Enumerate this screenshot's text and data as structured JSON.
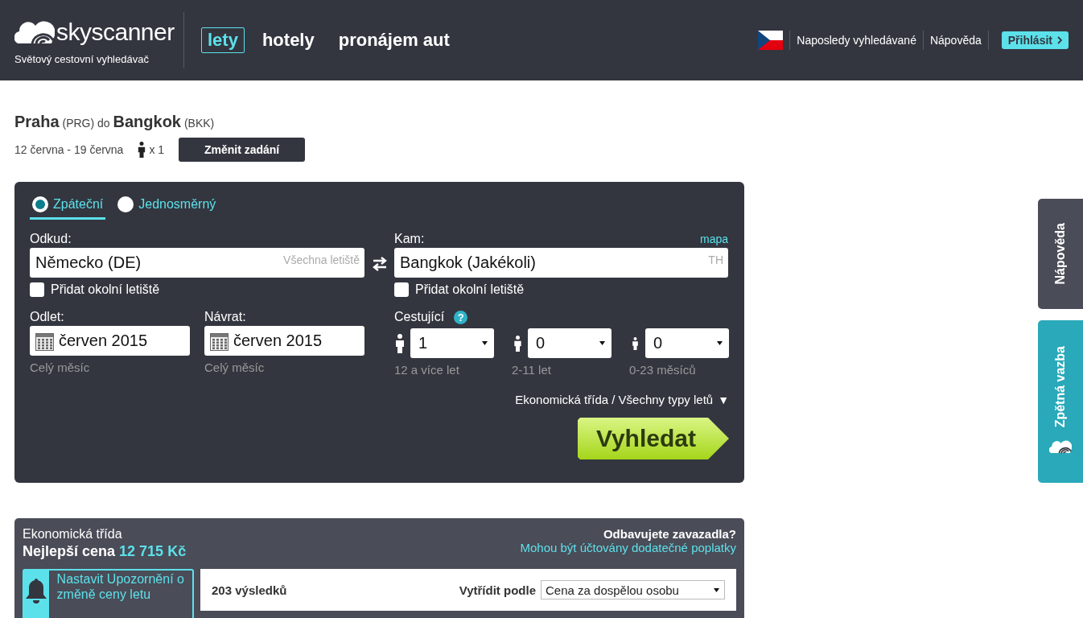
{
  "header": {
    "logo_text": "skyscanner",
    "tagline": "Světový cestovní vyhledávač",
    "nav": [
      {
        "label": "lety",
        "selected": true
      },
      {
        "label": "hotely",
        "selected": false
      },
      {
        "label": "pronájem aut",
        "selected": false
      }
    ],
    "links": [
      "Naposledy vyhledávané",
      "Nápověda"
    ],
    "login": "Přihlásit"
  },
  "summary": {
    "origin": "Praha",
    "origin_code": "(PRG)",
    "connector": "do",
    "destination": "Bangkok",
    "destination_code": "(BKK)",
    "dates": "12 června - 19 června",
    "travellers": "x 1",
    "change_button": "Změnit zadání"
  },
  "search_form": {
    "trip_types": [
      {
        "label": "Zpáteční",
        "selected": true
      },
      {
        "label": "Jednosměrný",
        "selected": false
      }
    ],
    "from": {
      "label": "Odkud:",
      "value": "Německo (DE)",
      "hint": "Všechna letiště",
      "nearby": {
        "label": "Přidat okolní letiště",
        "checked": false
      }
    },
    "to": {
      "label": "Kam:",
      "map_link": "mapa",
      "value": "Bangkok (Jakékoli)",
      "hint": "TH",
      "nearby": {
        "label": "Přidat okolní letiště",
        "checked": false
      }
    },
    "depart": {
      "label": "Odlet:",
      "value": "červen 2015",
      "note": "Celý měsíc"
    },
    "return": {
      "label": "Návrat:",
      "value": "červen 2015",
      "note": "Celý měsíc"
    },
    "passengers": {
      "label": "Cestující",
      "help": "?",
      "groups": [
        {
          "kind": "adult",
          "value": "1",
          "note": "12 a více let"
        },
        {
          "kind": "child",
          "value": "0",
          "note": "2-11 let"
        },
        {
          "kind": "infant",
          "value": "0",
          "note": "0-23 měsíců"
        }
      ]
    },
    "cabin": "Ekonomická třída / Všechny typy letů",
    "cabin_caret": "▼",
    "search_button": "Vyhledat"
  },
  "results": {
    "cabin": "Ekonomická třída",
    "best_label": "Nejlepší cena",
    "best_price": "12 715 Kč",
    "bags_title": "Odbavujete zavazadla?",
    "bags_note": "Mohou být účtovány dodatečné poplatky",
    "alert": "Nastavit Upozornění o změně ceny letu",
    "count": "203 výsledků",
    "sort_label": "Vytřídit podle",
    "sort_value": "Cena za dospělou osobu"
  },
  "side_tabs": [
    {
      "kind": "help",
      "label": "Nápověda"
    },
    {
      "kind": "feedback",
      "label": "Zpětná vazba"
    }
  ]
}
